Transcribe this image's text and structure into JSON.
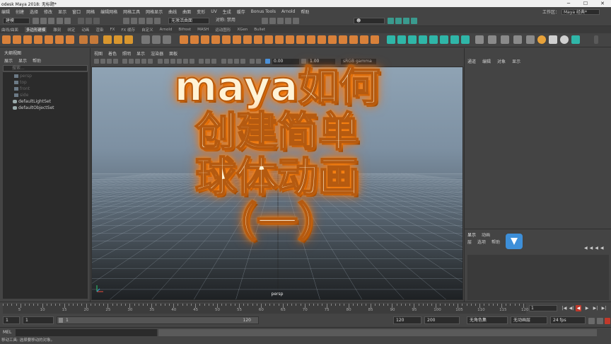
{
  "window": {
    "title": "odesk Maya 2018: 无标题*",
    "minimize": "─",
    "maximize": "☐",
    "close": "✕"
  },
  "menubar": {
    "items": [
      "编辑",
      "创建",
      "选择",
      "修改",
      "显示",
      "窗口",
      "网格",
      "编辑网格",
      "网格工具",
      "网格显示",
      "曲线",
      "曲面",
      "变形",
      "UV",
      "生成",
      "缓存",
      "Bonus Tools",
      "Arnold",
      "帮助"
    ],
    "workspace_label": "工作区：",
    "workspace_value": "Maya 经典*"
  },
  "statusline": {
    "mode": "建模",
    "live_surface": "无激活曲面",
    "symmetry": "对称: 禁用"
  },
  "shelf_tabs": {
    "items": [
      "曲线/曲面",
      "多边形建模",
      "雕刻",
      "绑定",
      "动画",
      "渲染",
      "FX",
      "FX 缓存",
      "自定义",
      "Arnold",
      "Bifrost",
      "MASH",
      "运动图形",
      "XGen",
      "Bullet"
    ],
    "active": 1
  },
  "shelf_right_labels": [
    "灰色",
    "高端灯光",
    "加重",
    "全部",
    "颜色"
  ],
  "outliner": {
    "title": "大纲视图",
    "menu": [
      "展示",
      "显示",
      "帮助"
    ],
    "search_placeholder": "搜索...",
    "items": [
      {
        "label": "persp",
        "dim": true
      },
      {
        "label": "top",
        "dim": true
      },
      {
        "label": "front",
        "dim": true
      },
      {
        "label": "side",
        "dim": true
      },
      {
        "label": "defaultLightSet",
        "dim": false
      },
      {
        "label": "defaultObjectSet",
        "dim": false
      }
    ]
  },
  "viewport": {
    "menu": [
      "视图",
      "着色",
      "照明",
      "显示",
      "渲染器",
      "面板"
    ],
    "exposure": "0.00",
    "gamma": "1.00",
    "color_space": "sRGB gamma",
    "camera_label": "persp"
  },
  "overlay_title": {
    "lines": [
      "maya如何",
      "创建简单",
      "球体动画",
      "（一）"
    ]
  },
  "channel_box": {
    "tabs": [
      "通道",
      "编辑",
      "对象",
      "显示"
    ]
  },
  "layer_editor": {
    "tabs": [
      "显示",
      "动画"
    ],
    "menu": [
      "层",
      "选项",
      "帮助"
    ]
  },
  "timeline": {
    "ticks": [
      "5",
      "10",
      "15",
      "20",
      "25",
      "30",
      "35",
      "40",
      "45",
      "50",
      "55",
      "60",
      "65",
      "70",
      "75",
      "80",
      "85",
      "90",
      "95",
      "100",
      "105",
      "110",
      "115",
      "120"
    ],
    "current_frame": "1",
    "playback": [
      "|◀",
      "◀|",
      "◀",
      "▶",
      "▶|",
      "▶|"
    ]
  },
  "range": {
    "start": "1",
    "start_inner": "1",
    "slider_start": "1",
    "slider_end": "120",
    "end_inner": "120",
    "end": "200",
    "character_set": "无角色集",
    "anim_layer": "无动画层",
    "fps": "24 fps"
  },
  "cmdline": {
    "lang": "MEL"
  },
  "help_line": "移动工具: 选择要移动的对象。",
  "colors": {
    "orange_icon": "#e0873a",
    "teal_icon": "#2fb6a8",
    "outline_text": "#b55a10",
    "glow": "#ff7a00"
  }
}
